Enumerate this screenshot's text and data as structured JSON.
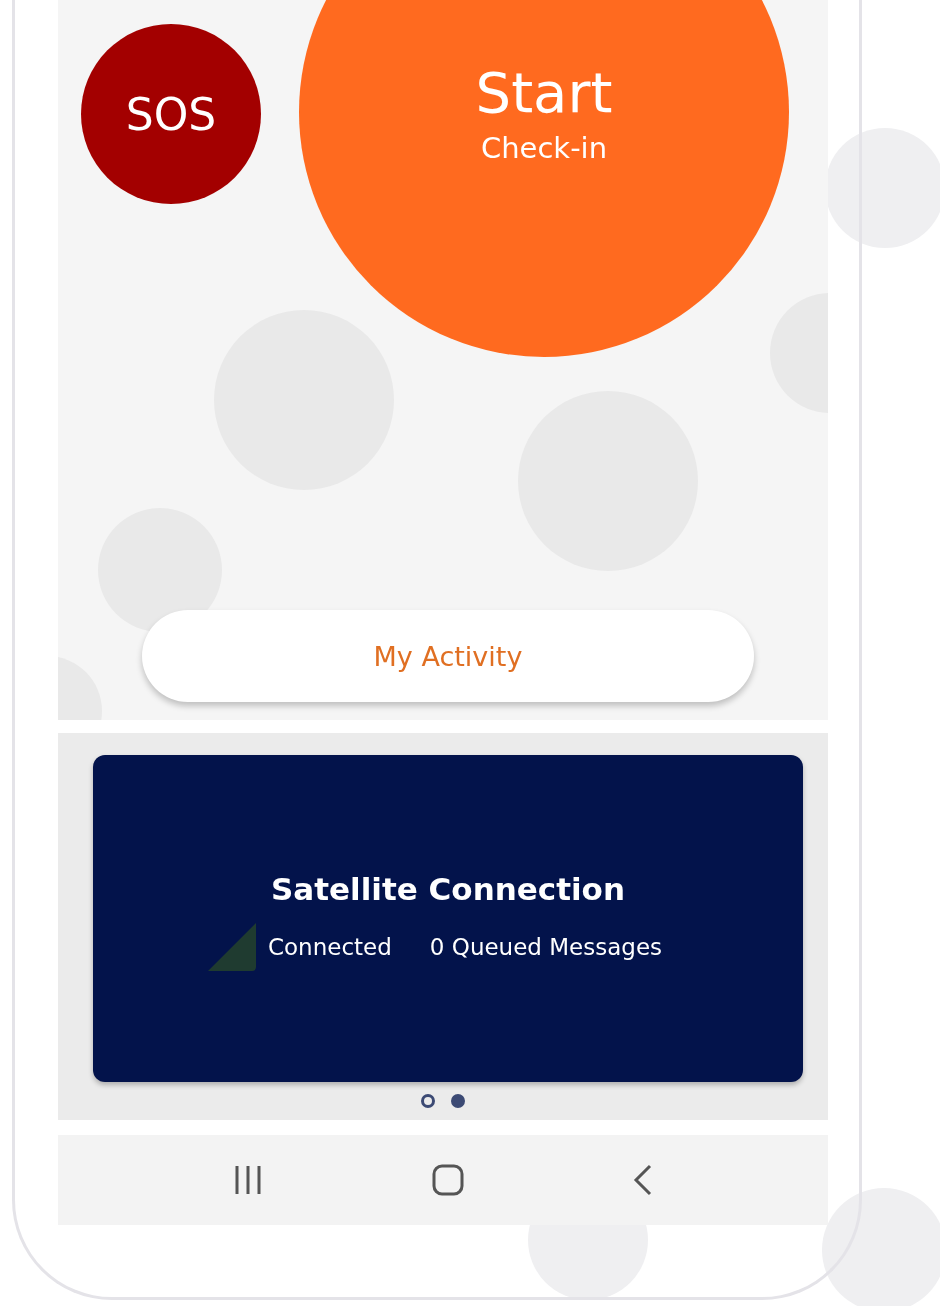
{
  "sos_button": {
    "label": "SOS"
  },
  "start_button": {
    "title": "Start",
    "subtitle": "Check-in"
  },
  "activity_button": {
    "label": "My Activity"
  },
  "status_card": {
    "title": "Satellite Connection",
    "status": "Connected",
    "queue": "0 Queued Messages"
  },
  "pager": [
    {
      "selected": false
    },
    {
      "selected": true
    }
  ],
  "nav_bar": [
    {
      "kind": "recents"
    },
    {
      "kind": "home"
    },
    {
      "kind": "back"
    }
  ]
}
